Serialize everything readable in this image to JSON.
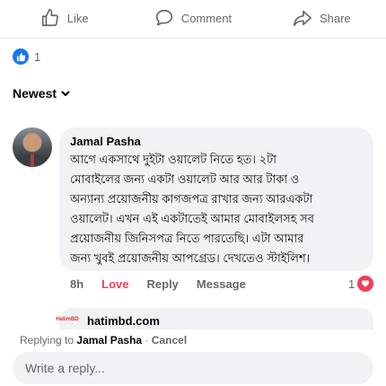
{
  "actions": {
    "like": "Like",
    "comment": "Comment",
    "share": "Share"
  },
  "post_reactions": {
    "count": "1"
  },
  "sort": {
    "label": "Newest"
  },
  "comment": {
    "author": "Jamal Pasha",
    "lines": [
      "আগে একসাথে দুইটা ওয়ালেট নিতে হত। ২টা",
      "মোবাইলের জন্য একটা ওয়ালেট আর আর টাকা ও",
      "অন্যান্য প্রয়োজনীয় কাগজপত্র রাখার জন্য আরএকটা",
      "ওয়ালেট। এখন এই একটাতেই আমার মোবাইলসহ সব",
      "প্রয়োজনীয় জিনিসপত্র নিতে পারতেছি। এটা আমার",
      "জন্য খুবই প্রয়োজনীয় আপগ্রেড। দেখতেও স্টাইলিশ।"
    ],
    "time": "8h",
    "love_label": "Love",
    "reply_label": "Reply",
    "message_label": "Message",
    "reaction_count": "1"
  },
  "reply_preview": {
    "avatar_text": "HatimBD",
    "name": "hatimbd.com"
  },
  "reply_bar": {
    "prefix": "Replying to",
    "target": "Jamal Pasha",
    "separator": "·",
    "cancel": "Cancel",
    "placeholder": "Write a reply..."
  },
  "colors": {
    "accent": "#1877f2",
    "love": "#f33e58",
    "muted": "#65676b",
    "bubble": "#f0f2f5"
  }
}
